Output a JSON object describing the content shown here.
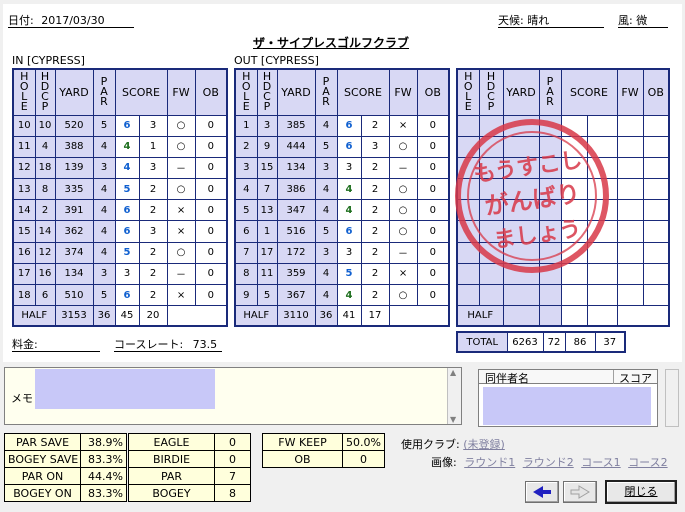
{
  "header": {
    "date_label": "日付:",
    "date_value": "2017/03/30",
    "weather_label": "天候:",
    "weather_value": "晴れ",
    "wind_label": "風:",
    "wind_value": "微",
    "course_title": "ザ・サイプレスゴルフクラブ"
  },
  "in_course": {
    "label": "IN [CYPRESS]"
  },
  "out_course": {
    "label": "OUT [CYPRESS]"
  },
  "columns": {
    "hole": "HOLE",
    "hdcp": "HDCP",
    "yard": "YARD",
    "par": "PAR",
    "score": "SCORE",
    "fw": "FW",
    "ob": "OB"
  },
  "in_rows": [
    {
      "hole": "10",
      "hdcp": "10",
      "yard": "520",
      "par": "5",
      "score": "6",
      "putt": "3",
      "fw": "○",
      "ob": "0",
      "color": "blue"
    },
    {
      "hole": "11",
      "hdcp": "4",
      "yard": "388",
      "par": "4",
      "score": "4",
      "putt": "1",
      "fw": "○",
      "ob": "0",
      "color": "green"
    },
    {
      "hole": "12",
      "hdcp": "18",
      "yard": "139",
      "par": "3",
      "score": "4",
      "putt": "3",
      "fw": "－",
      "ob": "0",
      "color": "blue"
    },
    {
      "hole": "13",
      "hdcp": "8",
      "yard": "335",
      "par": "4",
      "score": "5",
      "putt": "2",
      "fw": "○",
      "ob": "0",
      "color": "blue"
    },
    {
      "hole": "14",
      "hdcp": "2",
      "yard": "391",
      "par": "4",
      "score": "6",
      "putt": "2",
      "fw": "×",
      "ob": "0",
      "color": "blue"
    },
    {
      "hole": "15",
      "hdcp": "14",
      "yard": "362",
      "par": "4",
      "score": "6",
      "putt": "3",
      "fw": "×",
      "ob": "0",
      "color": "blue"
    },
    {
      "hole": "16",
      "hdcp": "12",
      "yard": "374",
      "par": "4",
      "score": "5",
      "putt": "2",
      "fw": "○",
      "ob": "0",
      "color": "blue"
    },
    {
      "hole": "17",
      "hdcp": "16",
      "yard": "134",
      "par": "3",
      "score": "3",
      "putt": "2",
      "fw": "－",
      "ob": "0",
      "color": "none"
    },
    {
      "hole": "18",
      "hdcp": "6",
      "yard": "510",
      "par": "5",
      "score": "6",
      "putt": "2",
      "fw": "×",
      "ob": "0",
      "color": "blue"
    }
  ],
  "in_half": {
    "label": "HALF",
    "yard": "3153",
    "par": "36",
    "score": "45",
    "putt": "20"
  },
  "out_rows": [
    {
      "hole": "1",
      "hdcp": "3",
      "yard": "385",
      "par": "4",
      "score": "6",
      "putt": "2",
      "fw": "×",
      "ob": "0",
      "color": "blue"
    },
    {
      "hole": "2",
      "hdcp": "9",
      "yard": "444",
      "par": "5",
      "score": "6",
      "putt": "3",
      "fw": "○",
      "ob": "0",
      "color": "blue"
    },
    {
      "hole": "3",
      "hdcp": "15",
      "yard": "134",
      "par": "3",
      "score": "3",
      "putt": "2",
      "fw": "－",
      "ob": "0",
      "color": "none"
    },
    {
      "hole": "4",
      "hdcp": "7",
      "yard": "386",
      "par": "4",
      "score": "4",
      "putt": "2",
      "fw": "○",
      "ob": "0",
      "color": "green"
    },
    {
      "hole": "5",
      "hdcp": "13",
      "yard": "347",
      "par": "4",
      "score": "4",
      "putt": "2",
      "fw": "○",
      "ob": "0",
      "color": "green"
    },
    {
      "hole": "6",
      "hdcp": "1",
      "yard": "516",
      "par": "5",
      "score": "6",
      "putt": "2",
      "fw": "○",
      "ob": "0",
      "color": "blue"
    },
    {
      "hole": "7",
      "hdcp": "17",
      "yard": "172",
      "par": "3",
      "score": "3",
      "putt": "2",
      "fw": "－",
      "ob": "0",
      "color": "none"
    },
    {
      "hole": "8",
      "hdcp": "11",
      "yard": "359",
      "par": "4",
      "score": "5",
      "putt": "2",
      "fw": "×",
      "ob": "0",
      "color": "blue"
    },
    {
      "hole": "9",
      "hdcp": "5",
      "yard": "367",
      "par": "4",
      "score": "4",
      "putt": "2",
      "fw": "○",
      "ob": "0",
      "color": "green"
    }
  ],
  "out_half": {
    "label": "HALF",
    "yard": "3110",
    "par": "36",
    "score": "41",
    "putt": "17"
  },
  "third_half": {
    "label": "HALF"
  },
  "total": {
    "label": "TOTAL",
    "yard": "6263",
    "par": "72",
    "score": "86",
    "putt": "37"
  },
  "stamp": {
    "line1": "もうすこし",
    "line2": "がんばり",
    "line3": "ましょう",
    "color": "#d83848"
  },
  "fee": {
    "label": "料金:"
  },
  "course_rate": {
    "label": "コースレート:",
    "value": "73.5"
  },
  "memo": {
    "label": "メモ"
  },
  "companions": {
    "name_header": "同伴者名",
    "score_header": "スコア"
  },
  "stats_left": [
    {
      "label": "PAR SAVE",
      "value": "38.9%"
    },
    {
      "label": "BOGEY SAVE",
      "value": "83.3%"
    },
    {
      "label": "PAR ON",
      "value": "44.4%"
    },
    {
      "label": "BOGEY ON",
      "value": "83.3%"
    }
  ],
  "stats_mid": [
    {
      "label": "EAGLE",
      "value": "0"
    },
    {
      "label": "BIRDIE",
      "value": "0"
    },
    {
      "label": "PAR",
      "value": "7"
    },
    {
      "label": "BOGEY",
      "value": "8"
    }
  ],
  "stats_right": [
    {
      "label": "FW KEEP",
      "value": "50.0%"
    },
    {
      "label": "OB",
      "value": "0"
    }
  ],
  "club": {
    "label": "使用クラブ:",
    "value": "(未登録)"
  },
  "images": {
    "label": "画像:",
    "links": [
      "ラウンド1",
      "ラウンド2",
      "コース1",
      "コース2"
    ]
  },
  "buttons": {
    "close": "閉じる"
  },
  "colors": {
    "table_border": "#1a2a7a",
    "header_bg": "#d8d8f4",
    "stats_bg": "#ffffdc",
    "blue": "#1060d0",
    "green": "#207020"
  }
}
